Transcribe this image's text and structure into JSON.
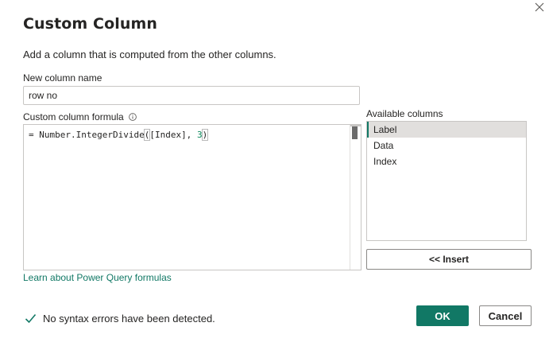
{
  "dialog": {
    "title": "Custom Column",
    "subtitle": "Add a column that is computed from the other columns.",
    "close_icon": "close-icon"
  },
  "column_name": {
    "label": "New column name",
    "value": "row no"
  },
  "formula": {
    "label": "Custom column formula",
    "info_icon": "info-icon",
    "prefix": "= Number.IntegerDivide",
    "open_paren": "(",
    "args": "[Index], ",
    "number": "3",
    "close_paren": ")"
  },
  "available_columns": {
    "label": "Available columns",
    "items": [
      {
        "label": "Label",
        "selected": true
      },
      {
        "label": "Data",
        "selected": false
      },
      {
        "label": "Index",
        "selected": false
      }
    ],
    "insert_label": "<< Insert"
  },
  "learn_link": "Learn about Power Query formulas",
  "status": {
    "icon": "checkmark-icon",
    "text": "No syntax errors have been detected."
  },
  "buttons": {
    "ok_label": "OK",
    "cancel_label": "Cancel"
  },
  "colors": {
    "accent": "#117865",
    "text": "#252423",
    "border": "#c8c6c4",
    "selected_bg": "#e1dfdd"
  }
}
